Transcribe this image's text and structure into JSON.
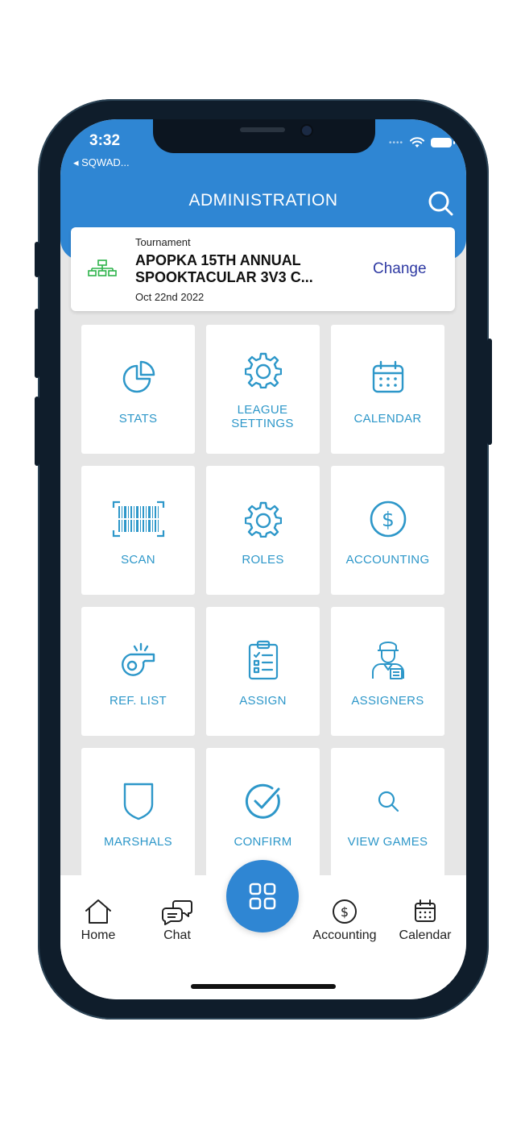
{
  "status": {
    "time": "3:32",
    "back_label": "◂ SQWAD..."
  },
  "header": {
    "title": "ADMINISTRATION"
  },
  "tournament": {
    "type_label": "Tournament",
    "name": "APOPKA 15TH ANNUAL SPOOKTACULAR 3V3 C...",
    "date": "Oct 22nd 2022",
    "change_label": "Change"
  },
  "tiles": [
    {
      "label": "STATS",
      "icon": "pie-chart-icon"
    },
    {
      "label": "LEAGUE SETTINGS",
      "icon": "gear-icon"
    },
    {
      "label": "CALENDAR",
      "icon": "calendar-icon"
    },
    {
      "label": "SCAN",
      "icon": "barcode-icon"
    },
    {
      "label": "ROLES",
      "icon": "gear-icon"
    },
    {
      "label": "ACCOUNTING",
      "icon": "dollar-icon"
    },
    {
      "label": "REF. LIST",
      "icon": "whistle-icon"
    },
    {
      "label": "ASSIGN",
      "icon": "clipboard-icon"
    },
    {
      "label": "ASSIGNERS",
      "icon": "official-icon"
    },
    {
      "label": "MARSHALS",
      "icon": "shield-icon"
    },
    {
      "label": "CONFIRM",
      "icon": "check-circle-icon"
    },
    {
      "label": "VIEW GAMES",
      "icon": "search-icon"
    }
  ],
  "nav": {
    "home": "Home",
    "chat": "Chat",
    "accounting": "Accounting",
    "calendar": "Calendar"
  },
  "colors": {
    "primary": "#2f86d3",
    "tile_text": "#2d97c9",
    "change_link": "#2f3aa3",
    "tourney_icon": "#2db34a"
  }
}
